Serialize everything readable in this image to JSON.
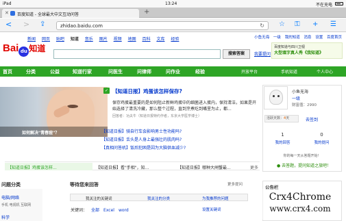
{
  "status_bar": {
    "device": "iPad",
    "time": "13:24",
    "charging": "不在充电"
  },
  "browser": {
    "tab_title": "百度知道 - 全球最大中文互动问答",
    "url": "zhidao.baidu.com",
    "new_tab": "+",
    "back": "<",
    "forward": ">"
  },
  "top_nav": {
    "links": [
      "新闻",
      "网页",
      "贴吧",
      "知道",
      "音乐",
      "图片",
      "视频",
      "地图",
      "百科",
      "文库",
      "经验"
    ],
    "current": "知道",
    "user": [
      "小鱼无海",
      "一级",
      "我的知道",
      "消息",
      "设置",
      "百度首页"
    ]
  },
  "logo": {
    "bai": "Bai",
    "paw": "du",
    "zhidao": "知道"
  },
  "search": {
    "button": "搜索答案",
    "ask": "我要提问"
  },
  "promo": {
    "line1": "百度知道与四川卫视",
    "line2": "大型填字真人秀《我知道》"
  },
  "menu": {
    "items": [
      "首页",
      "分类",
      "公益",
      "知道行家",
      "问医生",
      "问律师",
      "问作业",
      "经验"
    ],
    "right": [
      "开放平台",
      "手机知道",
      "个人中心"
    ]
  },
  "hero": {
    "caption": "如何解决\"青春痘\"？"
  },
  "article": {
    "title": "【知道日报】鸡蛋该怎样保存?",
    "summary": "保存鸡蛋最重要的是如何阻止新鲜鸡蛋中的细菌进入蛋内，保持清洁，如果是开始选择了清洗冷藏，那么整个过程，直到烹煮吃到嘴里为止，都...",
    "source": "回答者：功夫牛（知道日报特约作者，东京大学医学博士）"
  },
  "bullets": [
    "【知道日报】骑自行车会影响男士性功能吗?",
    "【知道日报】舌头是人身上最强壮的肌肉吗?",
    "【真相问答机】饭后犯困是因为大脑供血减少?"
  ],
  "user_card": {
    "name": "小鱼无海",
    "level": "一级",
    "wealth_label": "财富值：",
    "wealth": "2990",
    "checkin_label": "活跃天数：",
    "checkin_days": "4",
    "checkin_unit": "天",
    "signin": "去签到",
    "answers_count": "1",
    "answers_label": "我的回答",
    "questions_count": "0",
    "questions_label": "我的提问",
    "daily_tip": "你的每一天从答题开始！",
    "invite": "去答题，提问知道之旅吧！"
  },
  "ticker": {
    "items": [
      "【知道日报】鸡蛋该怎样...",
      "【知道日报】看\"手相\"，知...",
      "【知道日报】哪种大闸蟹最..."
    ],
    "more": "更多"
  },
  "categories": {
    "title": "问题分类",
    "items": [
      "电脑/网络",
      "手机 电视机 互联网",
      "科学"
    ]
  },
  "waiting": {
    "title": "等待您来回答",
    "more": "更多提问",
    "tabs": [
      "我关注的关键词",
      "我关注的分类",
      "为我推荐的问题"
    ],
    "keyword_label": "关键词：",
    "keywords": [
      "全部",
      "Excel",
      "word"
    ],
    "set_keyword": "设置关键词"
  },
  "notice": {
    "title": "公告栏"
  },
  "watermark": {
    "line1": "Crx4Chrome",
    "line2": "www.crx4.com"
  }
}
